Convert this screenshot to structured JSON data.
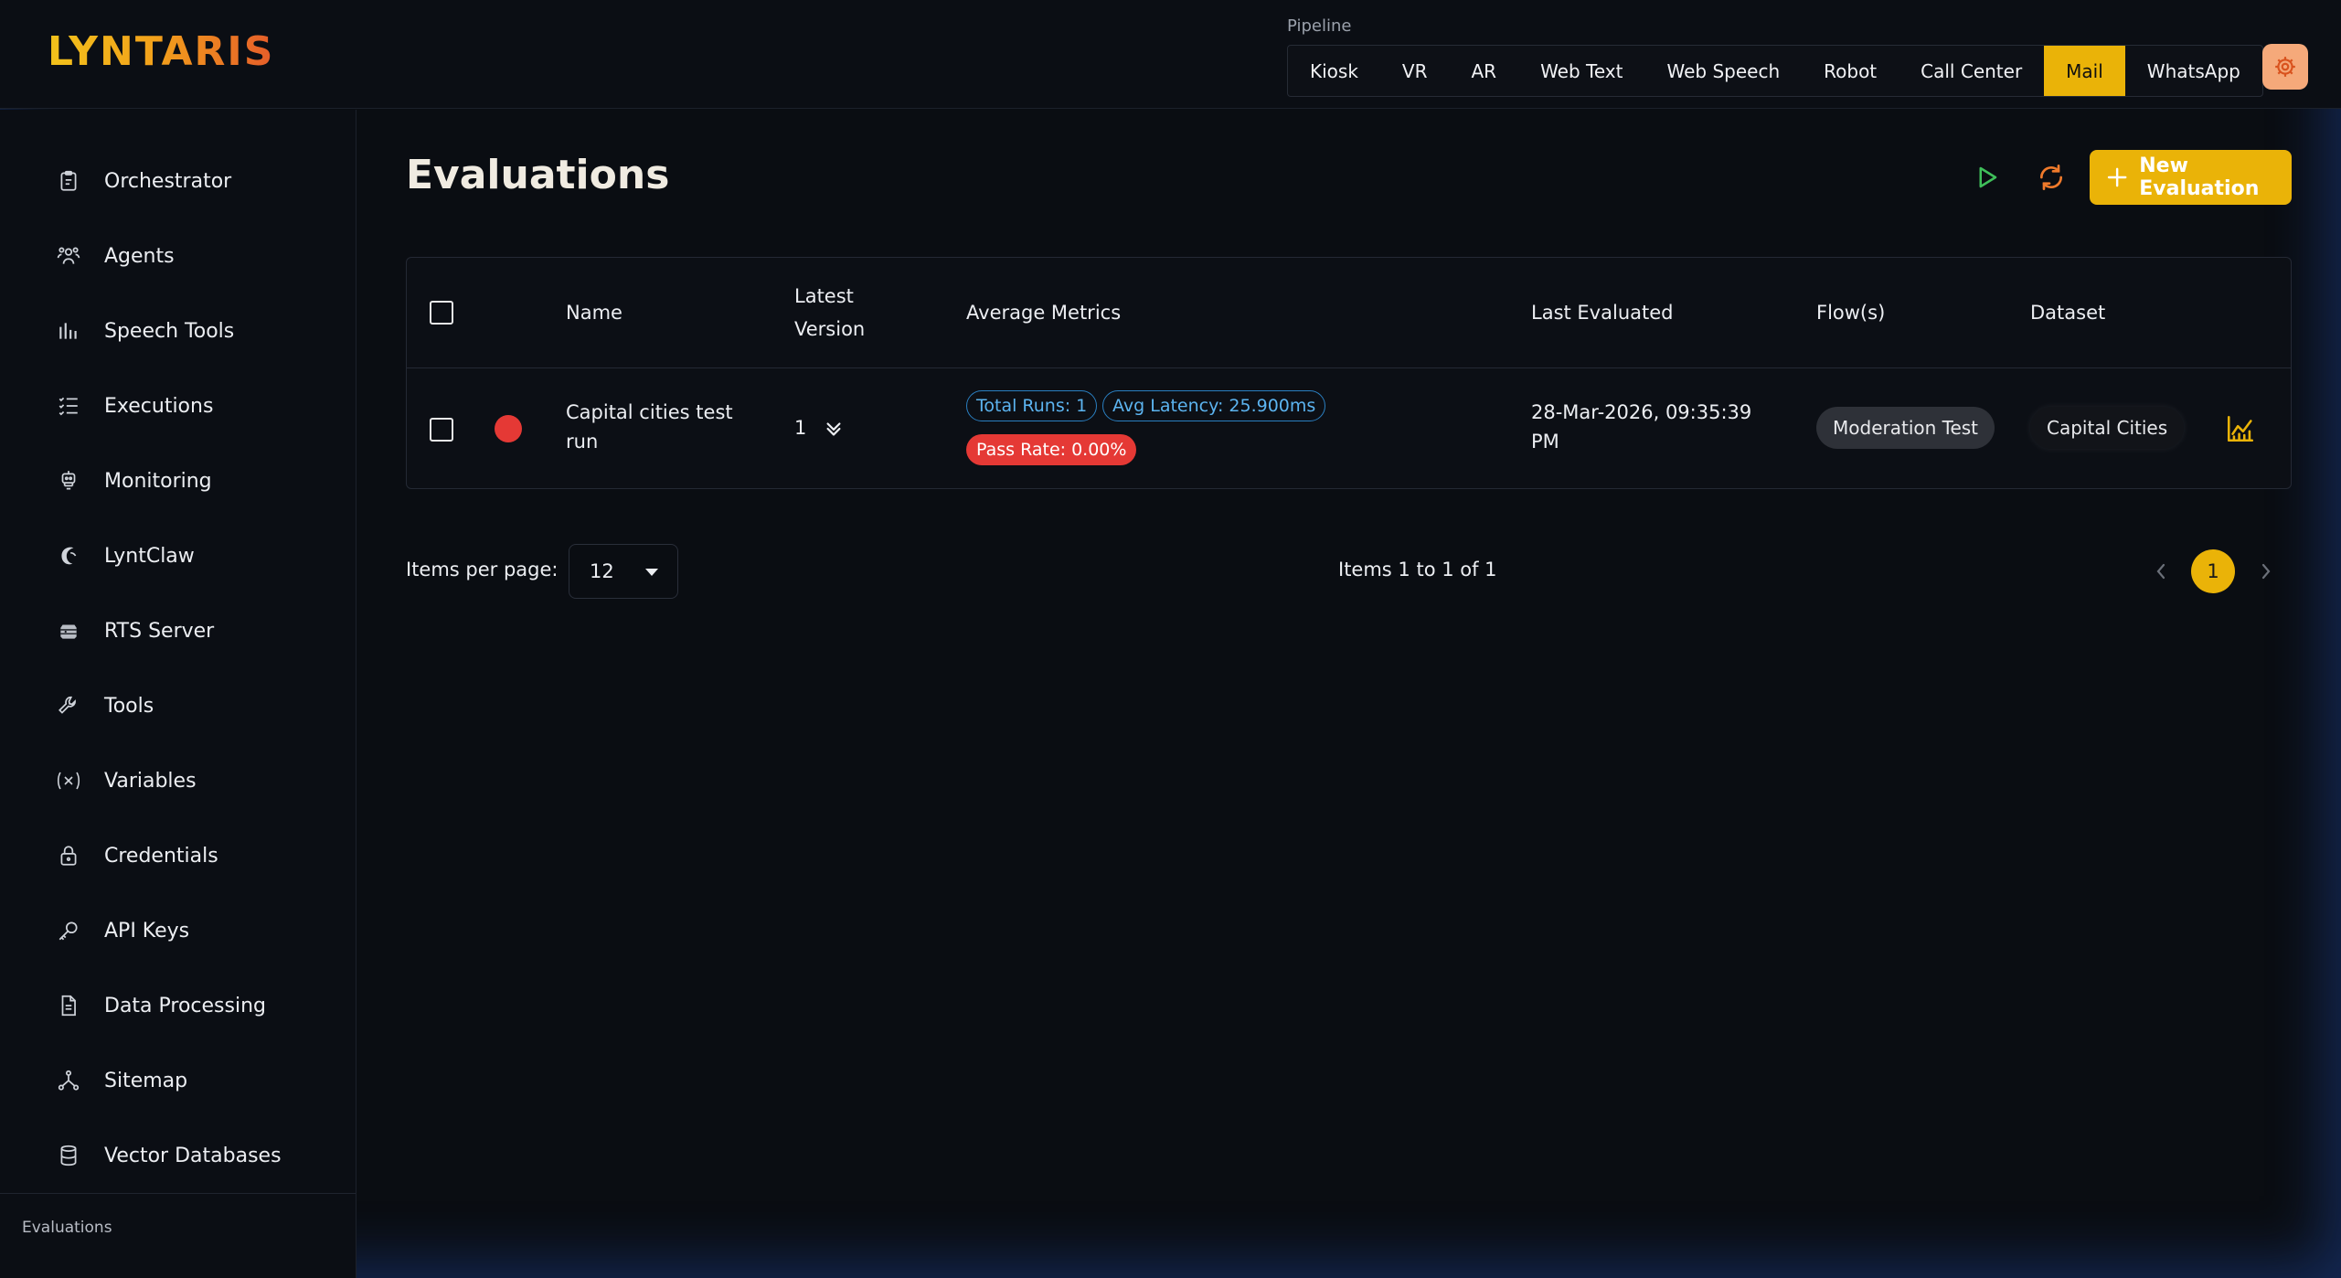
{
  "app": {
    "logo_text": "LYNTARIS"
  },
  "pipeline": {
    "label": "Pipeline",
    "tabs": [
      "Kiosk",
      "VR",
      "AR",
      "Web Text",
      "Web Speech",
      "Robot",
      "Call Center",
      "Mail",
      "WhatsApp"
    ],
    "active": "Mail"
  },
  "sidebar": {
    "items": [
      {
        "label": "Orchestrator",
        "icon": "clipboard-icon"
      },
      {
        "label": "Agents",
        "icon": "users-icon"
      },
      {
        "label": "Speech Tools",
        "icon": "bar-chart-icon"
      },
      {
        "label": "Executions",
        "icon": "list-check-icon"
      },
      {
        "label": "Monitoring",
        "icon": "robot-icon"
      },
      {
        "label": "LyntClaw",
        "icon": "claw-icon"
      },
      {
        "label": "RTS Server",
        "icon": "server-icon"
      },
      {
        "label": "Tools",
        "icon": "wrench-icon"
      },
      {
        "label": "Variables",
        "icon": "variable-icon"
      },
      {
        "label": "Credentials",
        "icon": "lock-icon"
      },
      {
        "label": "API Keys",
        "icon": "key-icon"
      },
      {
        "label": "Data Processing",
        "icon": "document-icon"
      },
      {
        "label": "Sitemap",
        "icon": "sitemap-icon"
      },
      {
        "label": "Vector Databases",
        "icon": "database-icon"
      }
    ],
    "section_label": "Evaluations"
  },
  "main": {
    "title": "Evaluations",
    "new_button_label": "New Evaluation",
    "table": {
      "headers": {
        "name": "Name",
        "latest_version_1": "Latest",
        "latest_version_2": "Version",
        "average_metrics": "Average Metrics",
        "last_evaluated": "Last Evaluated",
        "flows": "Flow(s)",
        "dataset": "Dataset"
      },
      "rows": [
        {
          "status_color": "#e53935",
          "name_line1": "Capital cities test",
          "name_line2": "run",
          "version": "1",
          "total_runs": "Total Runs: 1",
          "avg_latency": "Avg Latency: 25.900ms",
          "pass_rate": "Pass Rate: 0.00%",
          "last_evaluated_1": "28-Mar-2026, 09:35:39",
          "last_evaluated_2": "PM",
          "flow": "Moderation Test",
          "dataset": "Capital Cities"
        }
      ]
    }
  },
  "pagination": {
    "per_page_label": "Items per page:",
    "per_page_value": "12",
    "range_text": "Items 1 to 1 of 1",
    "current_page": "1"
  },
  "colors": {
    "accent": "#eab308",
    "status_fail": "#e53935",
    "play": "#3fbf5a",
    "refresh": "#f07a2b"
  }
}
